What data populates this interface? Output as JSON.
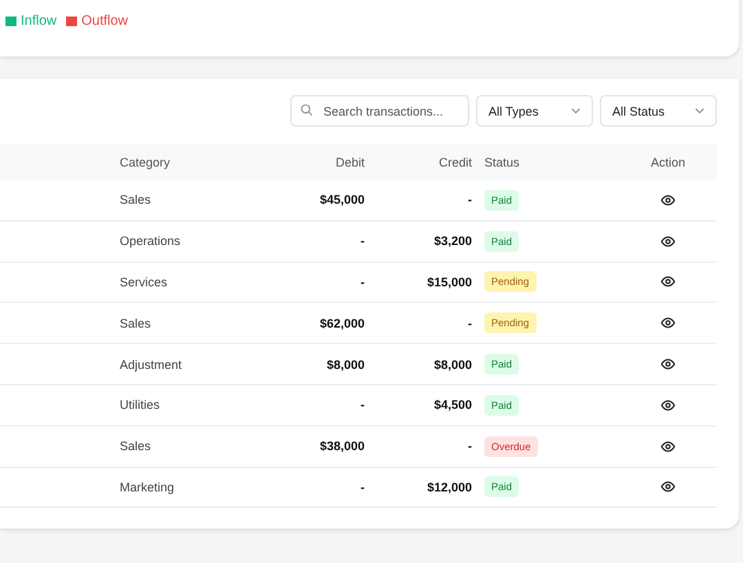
{
  "chart_legend": [
    {
      "label": "Inflow",
      "color": "#10b981"
    },
    {
      "label": "Outflow",
      "color": "#ef4444"
    }
  ],
  "filters": {
    "search": {
      "placeholder": "Search transactions..."
    },
    "dropdowns": [
      "All Types",
      "All Status"
    ]
  },
  "table": {
    "columns": [
      "Category",
      "Debit",
      "Credit",
      "Status",
      "Action"
    ],
    "rows": [
      {
        "category": "Sales",
        "debit": "$45,000",
        "credit": "-",
        "status": "Paid",
        "kind": "paid"
      },
      {
        "category": "Operations",
        "debit": "-",
        "credit": "$3,200",
        "status": "Paid",
        "kind": "paid"
      },
      {
        "category": "Services",
        "debit": "-",
        "credit": "$15,000",
        "status": "Pending",
        "kind": "pending"
      },
      {
        "category": "Sales",
        "debit": "$62,000",
        "credit": "-",
        "status": "Pending",
        "kind": "pending"
      },
      {
        "category": "Adjustment",
        "debit": "$8,000",
        "credit": "$8,000",
        "status": "Paid",
        "kind": "paid"
      },
      {
        "category": "Utilities",
        "debit": "-",
        "credit": "$4,500",
        "status": "Paid",
        "kind": "paid"
      },
      {
        "category": "Sales",
        "debit": "$38,000",
        "credit": "-",
        "status": "Overdue",
        "kind": "overdue"
      },
      {
        "category": "Marketing",
        "debit": "-",
        "credit": "$12,000",
        "status": "Paid",
        "kind": "paid"
      }
    ]
  }
}
